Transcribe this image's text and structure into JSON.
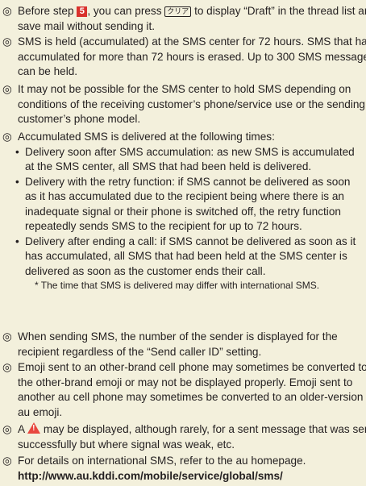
{
  "notes": {
    "n1": {
      "mark": "◎",
      "a": "Before step ",
      "step": "5",
      "b": ", you can press ",
      "key": "クリア",
      "c": " to display “Draft” in the thread list and save mail without sending it."
    },
    "n2": {
      "mark": "◎",
      "text": "SMS is held (accumulated) at the SMS center for 72 hours. SMS that has accumulated for more than 72 hours is erased. Up to 300 SMS messages can be held."
    },
    "n3": {
      "mark": "◎",
      "text": "It may not be possible for the SMS center to hold SMS depending on conditions of the receiving customer’s phone/service use or the sending customer’s phone model."
    },
    "n4": {
      "mark": "◎",
      "text": "Accumulated SMS is delivered at the following times:",
      "bullet": "•",
      "b1": "Delivery soon after SMS accumulation: as new SMS is accumulated at the SMS center, all SMS that had been held is delivered.",
      "b2": "Delivery with the retry function: if SMS cannot be delivered as soon as it has accumulated due to the recipient being where there is an inadequate signal or their phone is switched off, the retry function repeatedly sends SMS to the recipient for up to 72 hours.",
      "b3": "Delivery after ending a call: if SMS cannot be delivered as soon as it has accumulated, all SMS that had been held at the SMS center is delivered as soon as the customer ends their call.",
      "foot": "* The time that SMS is delivered may differ with international SMS."
    },
    "n5": {
      "mark": "◎",
      "text": "When sending SMS, the number of the sender is displayed for the recipient regardless of the “Send caller ID” setting."
    },
    "n6": {
      "mark": "◎",
      "text": "Emoji sent to an other-brand cell phone may sometimes be converted to the other-brand emoji or may not be displayed properly. Emoji sent to another au cell phone may sometimes be converted to an older-version au emoji."
    },
    "n7": {
      "mark": "◎",
      "a": "A ",
      "icon": "!",
      "b": " may be displayed, although rarely, for a sent message that was sent successfully but where signal was weak, etc."
    },
    "n8": {
      "mark": "◎",
      "text": "For details on international SMS, refer to the au homepage.",
      "url": "http://www.au.kddi.com/mobile/service/global/sms/"
    }
  }
}
